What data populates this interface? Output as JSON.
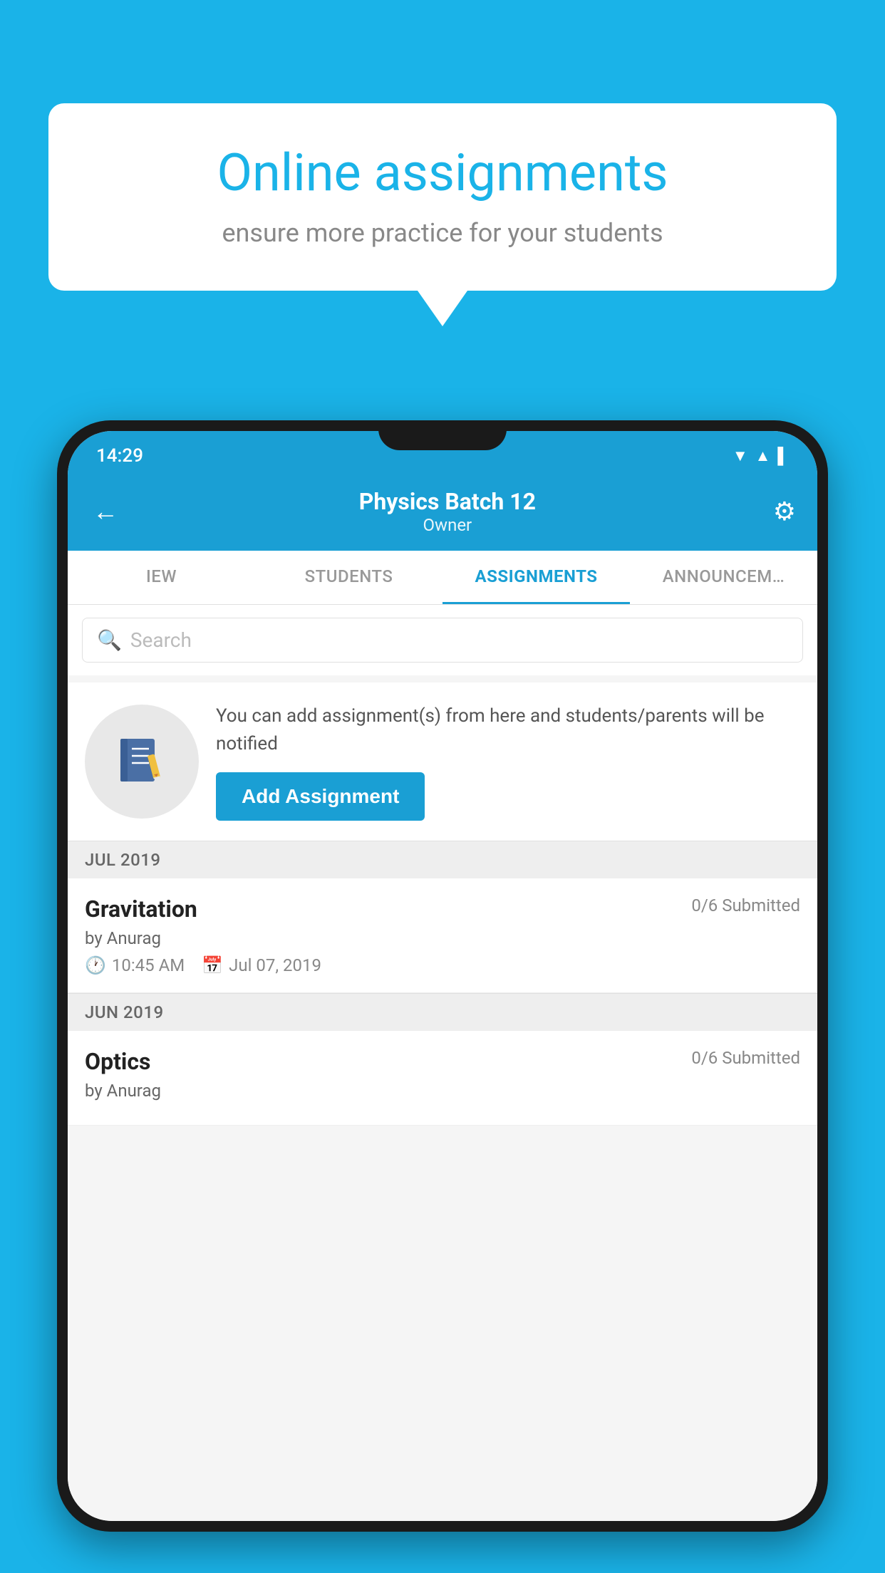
{
  "background": {
    "color": "#1ab3e8"
  },
  "speech_bubble": {
    "title": "Online assignments",
    "subtitle": "ensure more practice for your students"
  },
  "phone": {
    "status_bar": {
      "time": "14:29"
    },
    "header": {
      "title": "Physics Batch 12",
      "subtitle": "Owner",
      "back_label": "←",
      "gear_label": "⚙"
    },
    "tabs": [
      {
        "label": "IEW",
        "active": false
      },
      {
        "label": "STUDENTS",
        "active": false
      },
      {
        "label": "ASSIGNMENTS",
        "active": true
      },
      {
        "label": "ANNOUNCEM…",
        "active": false
      }
    ],
    "search": {
      "placeholder": "Search"
    },
    "promo": {
      "description": "You can add assignment(s) from here and students/parents will be notified",
      "button_label": "Add Assignment"
    },
    "sections": [
      {
        "month": "JUL 2019",
        "assignments": [
          {
            "title": "Gravitation",
            "submitted": "0/6 Submitted",
            "by": "by Anurag",
            "time": "10:45 AM",
            "date": "Jul 07, 2019"
          }
        ]
      },
      {
        "month": "JUN 2019",
        "assignments": [
          {
            "title": "Optics",
            "submitted": "0/6 Submitted",
            "by": "by Anurag",
            "time": "",
            "date": ""
          }
        ]
      }
    ]
  }
}
